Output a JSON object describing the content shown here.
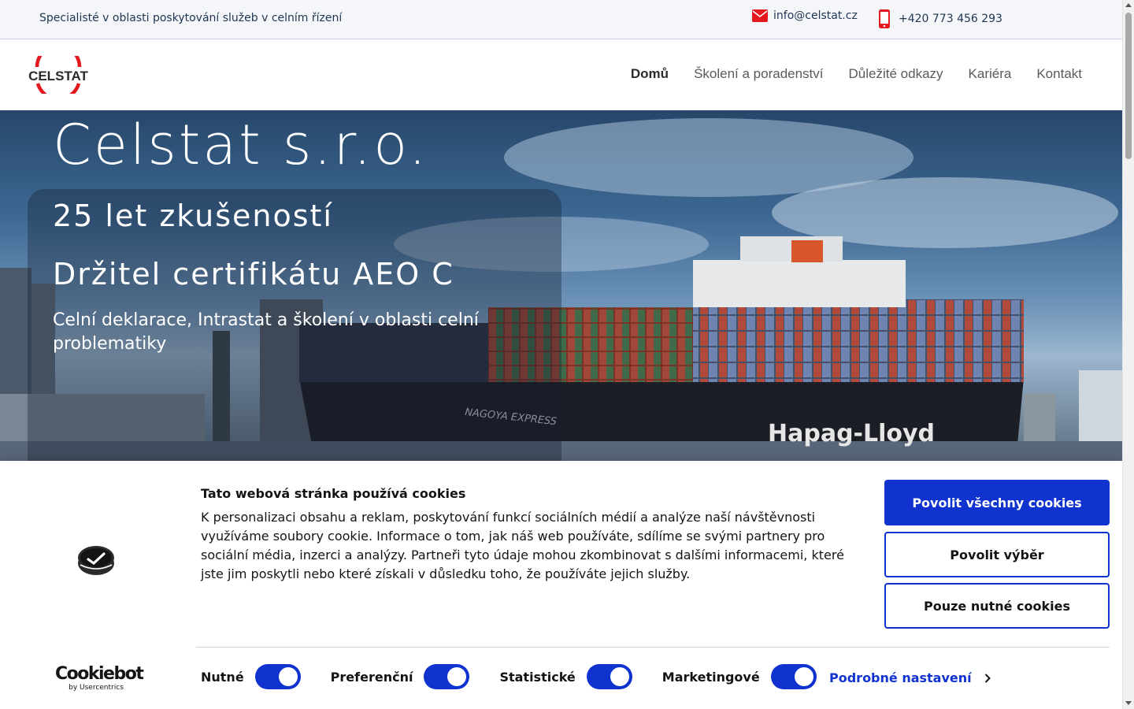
{
  "topbar": {
    "tagline": "Specialisté v oblasti poskytování služeb v celním řízení",
    "email": "info@celstat.cz",
    "phone": "+420 773 456 293",
    "accent": "#e3191f"
  },
  "header": {
    "logo_text": "CELSTAT",
    "nav": [
      {
        "label": "Domů",
        "active": true
      },
      {
        "label": "Školení a poradenství"
      },
      {
        "label": "Důležité odkazy"
      },
      {
        "label": "Kariéra"
      },
      {
        "label": "Kontakt"
      }
    ]
  },
  "hero": {
    "title": "Celstat s.r.o.",
    "line1": "25 let zkušeností",
    "line2": "Držitel certifikátu AEO C",
    "line3": "Celní deklarace, Intrastat a školení v oblasti celní problematiky",
    "ship_name": "NAGOYA EXPRESS",
    "hull_text": "Hapag-Lloyd"
  },
  "cookie": {
    "title": "Tato webová stránka používá cookies",
    "text": "K personalizaci obsahu a reklam, poskytování funkcí sociálních médií a analýze naší návštěvnosti využíváme soubory cookie. Informace o tom, jak náš web používáte, sdílíme se svými partnery pro sociální média, inzerci a analýzy. Partneři tyto údaje mohou zkombinovat s dalšími informacemi, které jste jim poskytli nebo které získali v důsledku toho, že používáte jejich služby.",
    "btn_allow_all": "Povolit všechny cookies",
    "btn_allow_selection": "Povolit výběr",
    "btn_necessary": "Pouze nutné cookies",
    "brand": "Cookiebot",
    "brand_by": "by Usercentrics",
    "toggles": [
      {
        "label": "Nutné",
        "on": true
      },
      {
        "label": "Preferenční",
        "on": true
      },
      {
        "label": "Statistické",
        "on": true
      },
      {
        "label": "Marketingové",
        "on": true
      }
    ],
    "details_label": "Podrobné nastavení",
    "accent": "#1032cf"
  }
}
